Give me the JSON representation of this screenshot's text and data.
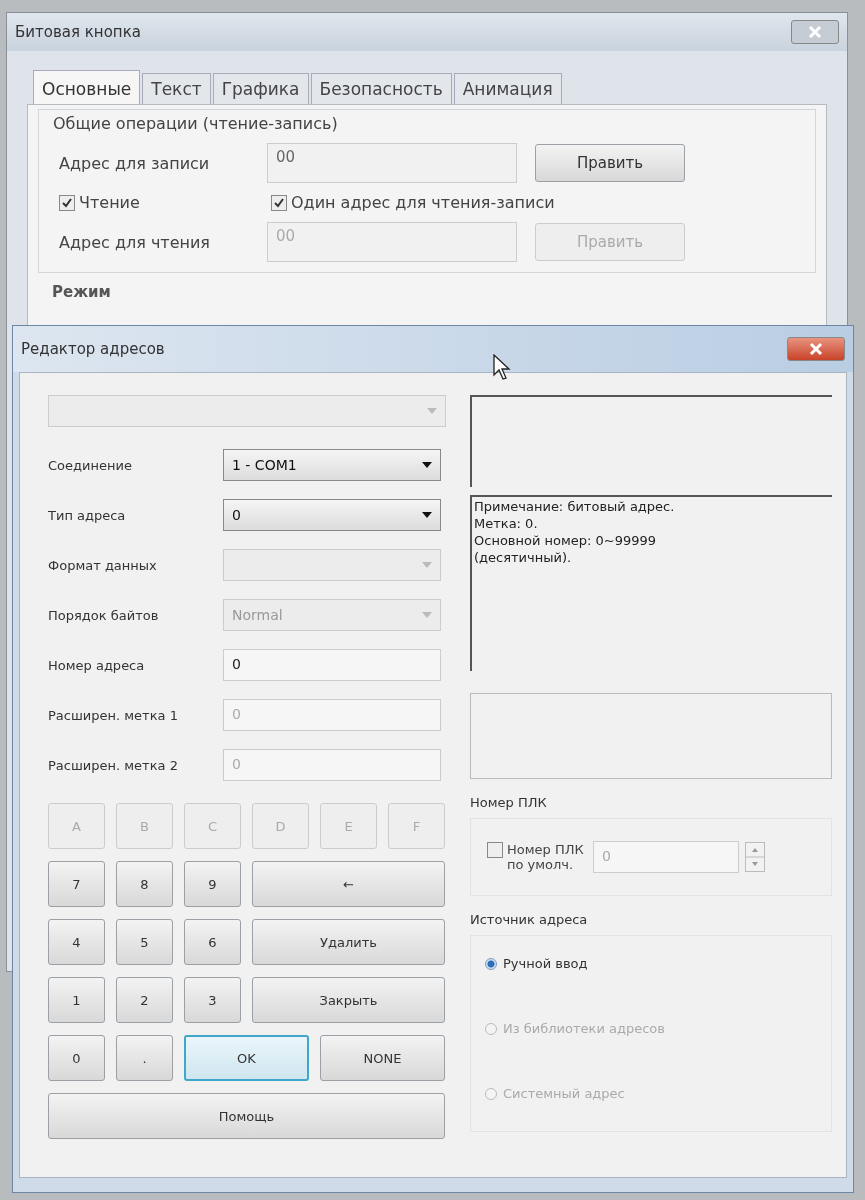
{
  "main_window": {
    "title": "Битовая кнопка",
    "tabs": [
      {
        "label": "Основные",
        "selected": true
      },
      {
        "label": "Текст",
        "selected": false
      },
      {
        "label": "Графика",
        "selected": false
      },
      {
        "label": "Безопасность",
        "selected": false
      },
      {
        "label": "Анимация",
        "selected": false
      }
    ],
    "group_title": "Общие операции (чтение-запись)",
    "write_address": {
      "label": "Адрес для записи",
      "value": "00",
      "button": "Править",
      "disabled": false
    },
    "read_checkbox": {
      "label": "Чтение",
      "checked": true
    },
    "same_address_checkbox": {
      "label": "Один адрес для чтения-записи",
      "checked": true
    },
    "read_address": {
      "label": "Адрес для чтения",
      "value": "00",
      "button": "Править",
      "disabled": true
    },
    "mode_label": "Режим"
  },
  "address_editor": {
    "title": "Редактор адресов",
    "top_dropdown": {
      "disabled": true
    },
    "fields": [
      {
        "kind": "select",
        "label": "Соединение",
        "value": "1 - COM1",
        "disabled": false
      },
      {
        "kind": "select",
        "label": "Тип адреса",
        "value": "0",
        "disabled": false
      },
      {
        "kind": "select",
        "label": "Формат данных",
        "disabled": true
      },
      {
        "kind": "select",
        "label": "Порядок байтов",
        "value": "Normal",
        "disabled": true
      },
      {
        "kind": "input",
        "label": "Номер адреса",
        "value": "0",
        "disabled": false
      },
      {
        "kind": "input",
        "label": "Расширен. метка 1",
        "value": "0",
        "disabled": true
      },
      {
        "kind": "input",
        "label": "Расширен. метка 2",
        "value": "0",
        "disabled": true
      }
    ],
    "note_lines": [
      "Примечание: битовый адрес.",
      "Метка: 0.",
      "Основной номер: 0~99999",
      "(десятичный)."
    ],
    "keypad": [
      {
        "kind": "small",
        "label": "A",
        "disabled": true,
        "focused": false
      },
      {
        "kind": "small",
        "label": "B",
        "disabled": true,
        "focused": false
      },
      {
        "kind": "small",
        "label": "C",
        "disabled": true,
        "focused": false
      },
      {
        "kind": "small",
        "label": "D",
        "disabled": true,
        "focused": false
      },
      {
        "kind": "small",
        "label": "E",
        "disabled": true,
        "focused": false
      },
      {
        "kind": "small",
        "label": "F",
        "disabled": true,
        "focused": false
      },
      {
        "kind": "small",
        "label": "7",
        "disabled": false,
        "focused": false
      },
      {
        "kind": "small",
        "label": "8",
        "disabled": false,
        "focused": false
      },
      {
        "kind": "small",
        "label": "9",
        "disabled": false,
        "focused": false
      },
      {
        "kind": "wide",
        "label": "←",
        "disabled": false,
        "focused": false
      },
      {
        "kind": "small",
        "label": "4",
        "disabled": false,
        "focused": false
      },
      {
        "kind": "small",
        "label": "5",
        "disabled": false,
        "focused": false
      },
      {
        "kind": "small",
        "label": "6",
        "disabled": false,
        "focused": false
      },
      {
        "kind": "wide",
        "label": "Удалить",
        "disabled": false,
        "focused": false
      },
      {
        "kind": "small",
        "label": "1",
        "disabled": false,
        "focused": false
      },
      {
        "kind": "small",
        "label": "2",
        "disabled": false,
        "focused": false
      },
      {
        "kind": "small",
        "label": "3",
        "disabled": false,
        "focused": false
      },
      {
        "kind": "wide",
        "label": "Закрыть",
        "disabled": false,
        "focused": false
      },
      {
        "kind": "small",
        "label": "0",
        "disabled": false,
        "focused": false
      },
      {
        "kind": "small",
        "label": ".",
        "disabled": false,
        "focused": false
      },
      {
        "kind": "half",
        "label": "OK",
        "disabled": false,
        "focused": true
      },
      {
        "kind": "half",
        "label": "NONE",
        "disabled": false,
        "focused": false
      },
      {
        "kind": "full",
        "label": "Помощь",
        "disabled": false,
        "focused": false
      }
    ],
    "plc": {
      "group_title": "Номер ПЛК",
      "checkbox_label": "Номер ПЛК по умолч.",
      "checked": false,
      "value": "0"
    },
    "source": {
      "group_title": "Источник адреса",
      "options": [
        {
          "label": "Ручной ввод",
          "selected": true,
          "disabled": false
        },
        {
          "label": "Из библиотеки адресов",
          "selected": false,
          "disabled": true
        },
        {
          "label": "Системный адрес",
          "selected": false,
          "disabled": true
        }
      ]
    }
  }
}
